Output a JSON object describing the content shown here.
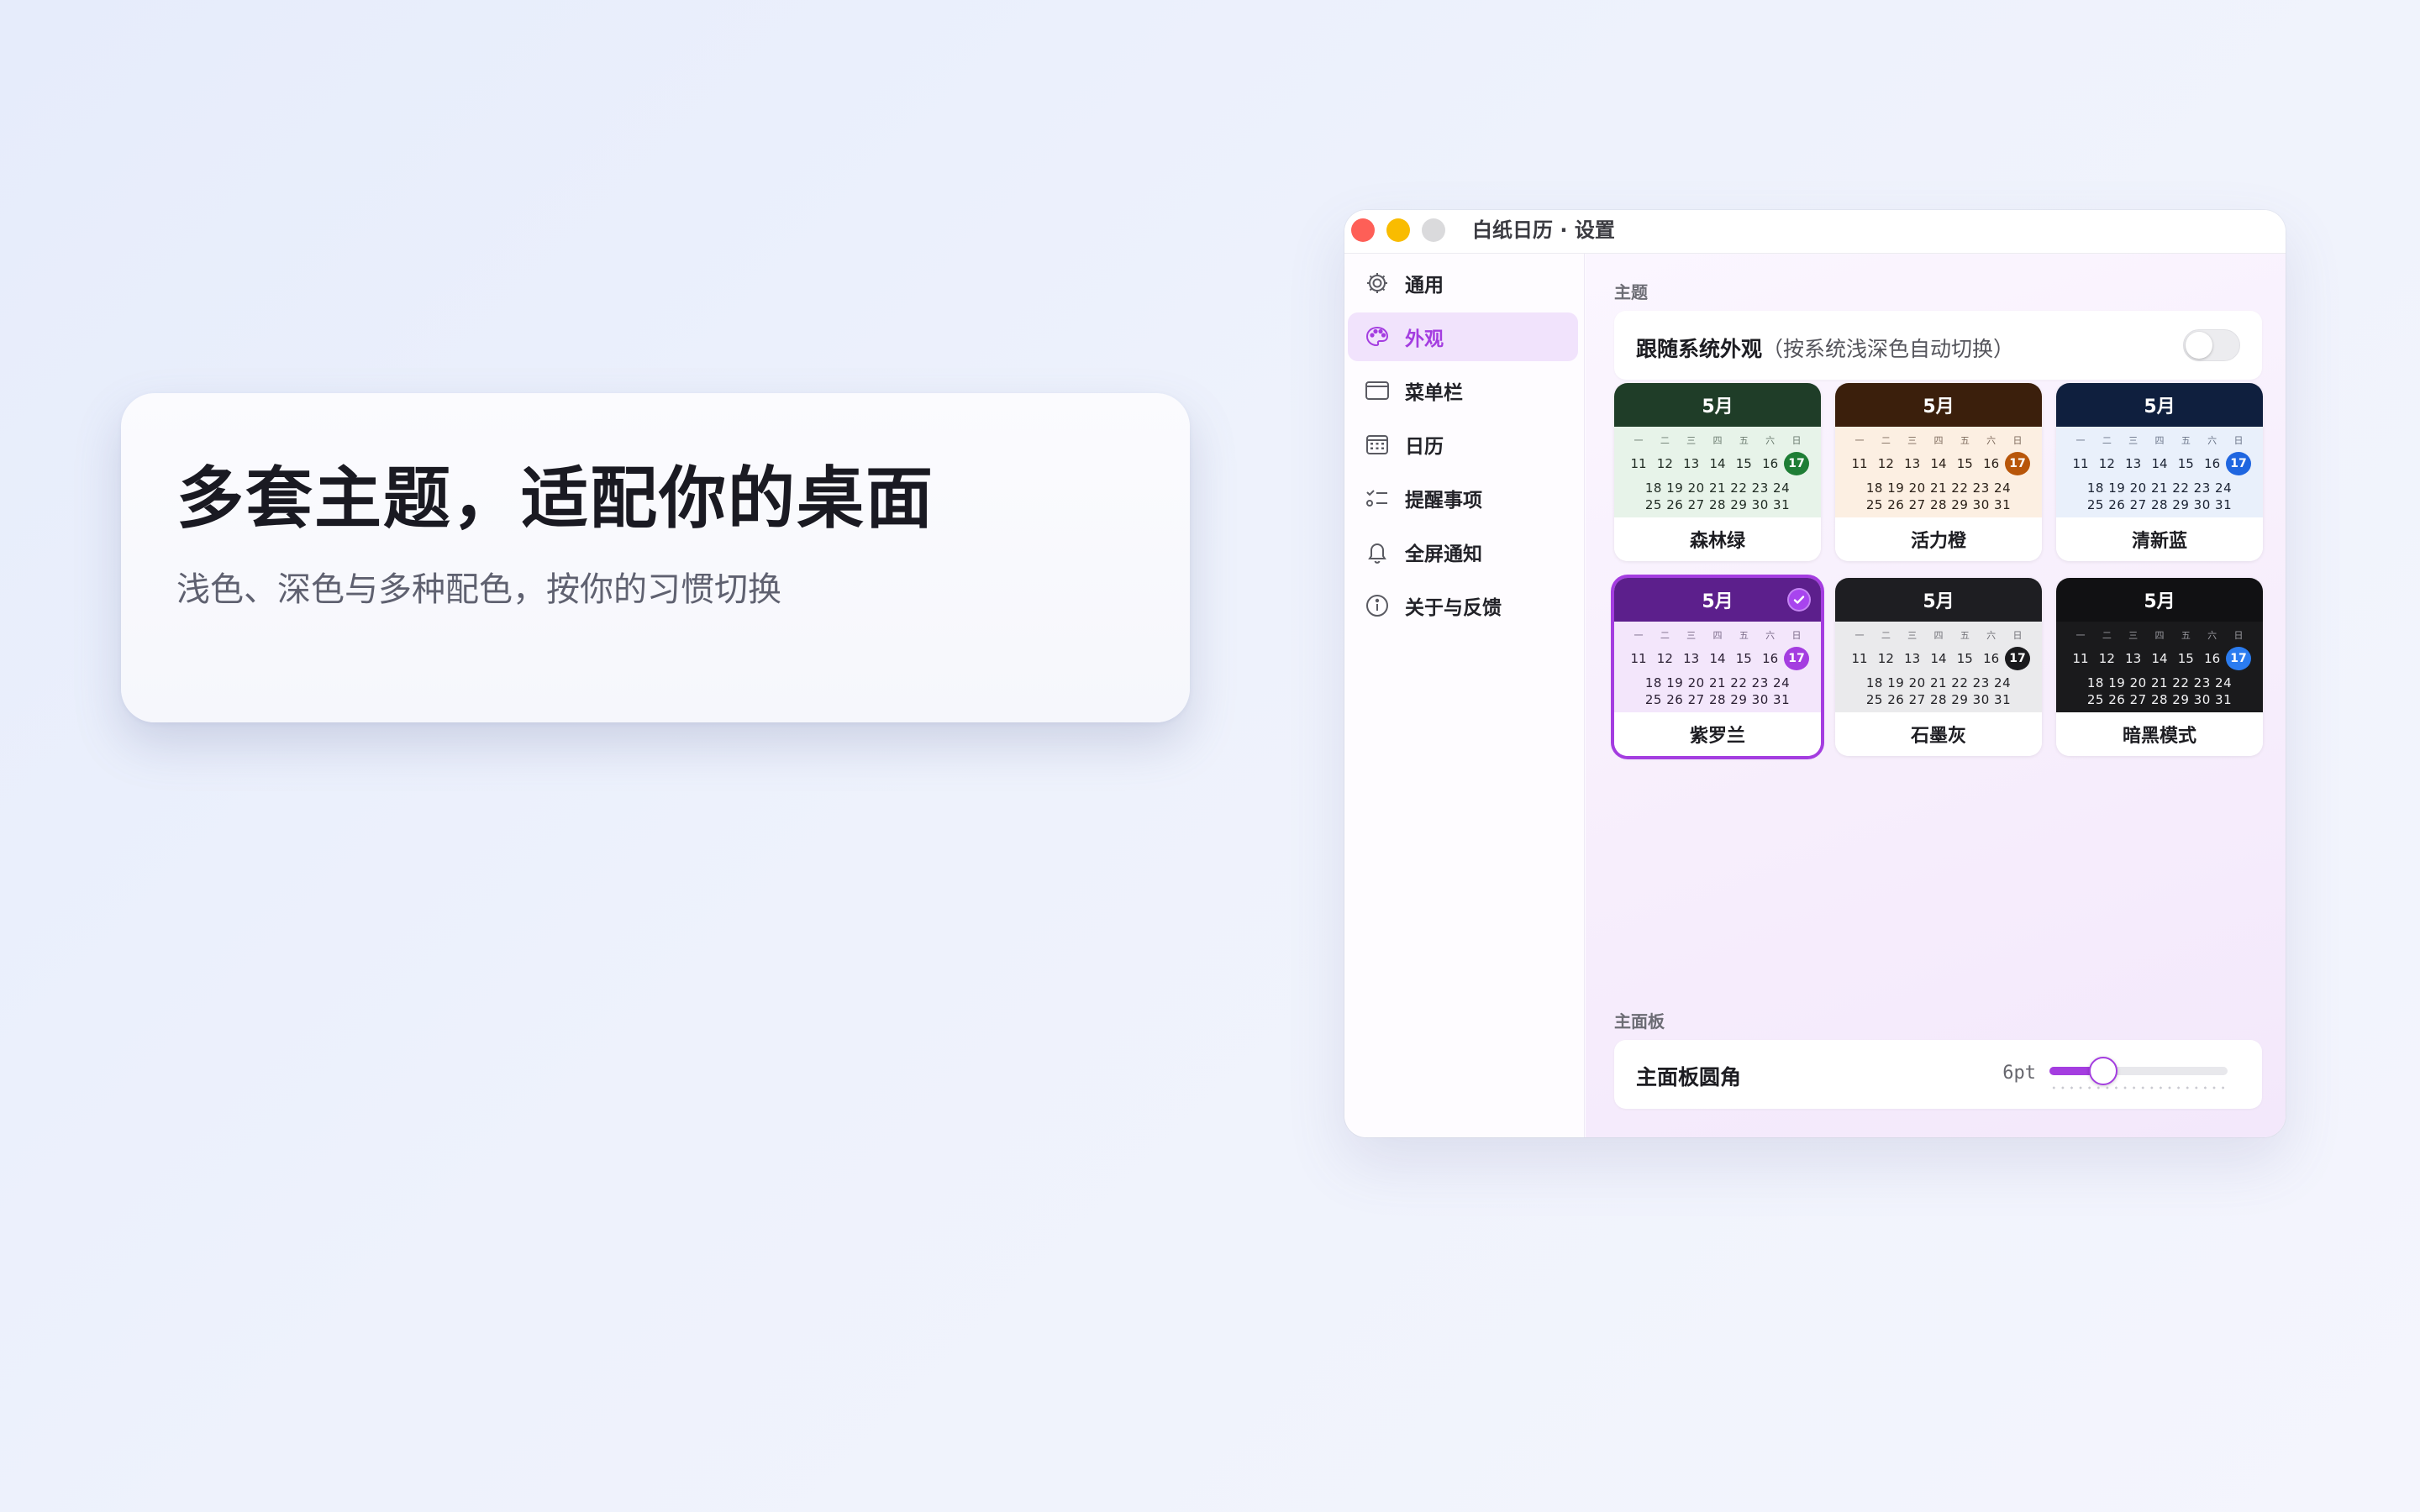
{
  "promo": {
    "title": "多套主题，适配你的桌面",
    "subtitle": "浅色、深色与多种配色，按你的习惯切换"
  },
  "window": {
    "title": "白纸日历 · 设置"
  },
  "sidebar": {
    "items": [
      {
        "label": "通用",
        "icon": "gear-icon"
      },
      {
        "label": "外观",
        "icon": "palette-icon",
        "active": true
      },
      {
        "label": "菜单栏",
        "icon": "menubar-icon"
      },
      {
        "label": "日历",
        "icon": "calendar-icon"
      },
      {
        "label": "提醒事项",
        "icon": "checklist-icon"
      },
      {
        "label": "全屏通知",
        "icon": "bell-icon"
      },
      {
        "label": "关于与反馈",
        "icon": "info-icon"
      }
    ],
    "accent": "#a43de0"
  },
  "theme_section": {
    "label": "主题",
    "follow_system": {
      "label": "跟随系统外观",
      "note": "（按系统浅深色自动切换）",
      "enabled": false
    },
    "calendar_preview": {
      "month": "5月",
      "weekdays": [
        "一",
        "二",
        "三",
        "四",
        "五",
        "六",
        "日"
      ],
      "row1": [
        "11",
        "12",
        "13",
        "14",
        "15",
        "16",
        "17"
      ],
      "row2": "18 19 20 21 22 23 24",
      "row3": "25 26 27 28 29 30 31",
      "today": "17"
    },
    "themes": [
      {
        "name": "森林绿",
        "header": "#1f3d28",
        "body": "#e7f3e9",
        "text": "#1f2a22",
        "weekday": "#6a7a6e",
        "today": "#1e7d35",
        "selected": false
      },
      {
        "name": "活力橙",
        "header": "#3b1f0c",
        "body": "#fcefe2",
        "text": "#2a2018",
        "weekday": "#7d6a5c",
        "today": "#b8560a",
        "selected": false
      },
      {
        "name": "清新蓝",
        "header": "#0f1f3e",
        "body": "#e9f0fb",
        "text": "#1a2232",
        "weekday": "#6a7488",
        "today": "#1f66e0",
        "selected": false
      },
      {
        "name": "紫罗兰",
        "header": "#5c1f8c",
        "body": "#f3e6fb",
        "text": "#2a1f33",
        "weekday": "#7a6a88",
        "today": "#a43de0",
        "selected": true
      },
      {
        "name": "石墨灰",
        "header": "#1e1e22",
        "body": "#eaeaec",
        "text": "#222226",
        "weekday": "#707076",
        "today": "#1a1a1d",
        "selected": false
      },
      {
        "name": "暗黑模式",
        "header": "#111113",
        "body": "#1a1a1c",
        "text": "#f2f2f4",
        "weekday": "#9a9aa0",
        "today": "#2b7cf0",
        "selected": false
      }
    ]
  },
  "panel_section": {
    "label": "主面板",
    "corner_radius": {
      "label": "主面板圆角",
      "value_text": "6pt",
      "value_fraction": 0.3
    }
  }
}
